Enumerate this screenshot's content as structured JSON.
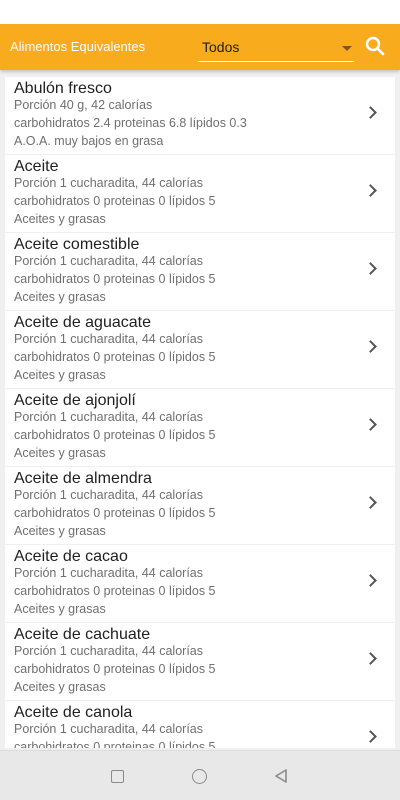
{
  "app": {
    "title": "Alimentos Equivalentes",
    "filter_value": "Todos",
    "accent_color": "#f9ab1e"
  },
  "icons": {
    "search": "search-icon",
    "dropdown": "chevron-down-icon",
    "item_arrow": "chevron-right-icon",
    "nav_recents": "square-icon",
    "nav_home": "circle-icon",
    "nav_back": "triangle-back-icon"
  },
  "items": [
    {
      "name": "Abulón fresco",
      "portion": "Porción 40 g, 42 calorías",
      "macros": "carbohidratos 2.4 proteinas 6.8 lípidos 0.3",
      "group": "A.O.A. muy bajos en grasa"
    },
    {
      "name": "Aceite",
      "portion": "Porción 1 cucharadita, 44 calorías",
      "macros": "carbohidratos 0 proteinas 0 lípidos 5",
      "group": "Aceites y grasas"
    },
    {
      "name": "Aceite comestible",
      "portion": "Porción 1 cucharadita, 44 calorías",
      "macros": "carbohidratos 0 proteinas 0 lípidos 5",
      "group": "Aceites y grasas"
    },
    {
      "name": "Aceite de aguacate",
      "portion": "Porción 1 cucharadita, 44 calorías",
      "macros": "carbohidratos 0 proteinas 0 lípidos 5",
      "group": "Aceites y grasas"
    },
    {
      "name": "Aceite de ajonjolí",
      "portion": "Porción 1 cucharadita, 44 calorías",
      "macros": "carbohidratos 0 proteinas 0 lípidos 5",
      "group": "Aceites y grasas"
    },
    {
      "name": "Aceite de almendra",
      "portion": "Porción 1 cucharadita, 44 calorías",
      "macros": "carbohidratos 0 proteinas 0 lípidos 5",
      "group": "Aceites y grasas"
    },
    {
      "name": "Aceite de cacao",
      "portion": "Porción 1 cucharadita, 44 calorías",
      "macros": "carbohidratos 0 proteinas 0 lípidos 5",
      "group": "Aceites y grasas"
    },
    {
      "name": "Aceite de cachuate",
      "portion": "Porción 1 cucharadita, 44 calorías",
      "macros": "carbohidratos 0 proteinas 0 lípidos 5",
      "group": "Aceites y grasas"
    },
    {
      "name": "Aceite de canola",
      "portion": "Porción 1 cucharadita, 44 calorías",
      "macros": "carbohidratos 0 proteinas 0 lípidos 5",
      "group": ""
    }
  ]
}
